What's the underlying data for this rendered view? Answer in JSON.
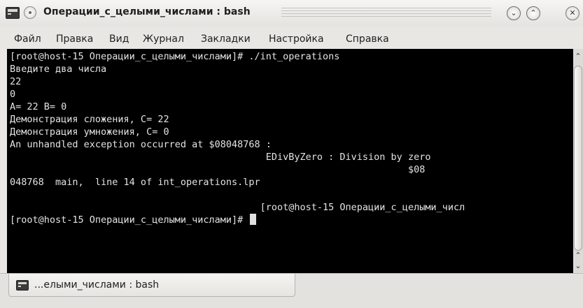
{
  "window": {
    "title": "Операции_с_целыми_числами : bash",
    "minimize_icon": "chevron-down",
    "maximize_icon": "chevron-up",
    "close_icon": "x"
  },
  "menu": [
    "Файл",
    "Правка",
    "Вид",
    "Журнал",
    "Закладки",
    "Настройка",
    "Справка"
  ],
  "terminal": {
    "lines": [
      "[root@host-15 Операции_с_целыми_числами]# ./int_operations",
      "Введите два числа",
      "22",
      "0",
      "A= 22 B= 0",
      "Демонстрация сложения, C= 22",
      "Демонстрация умножения, C= 0",
      "An unhandled exception occurred at $08048768 :",
      "                                             EDivByZero : Division by zero",
      "                                                                      $08",
      "048768  main,  line 14 of int_operations.lpr",
      "",
      "                                            [root@host-15 Операции_с_целыми_числ",
      "[root@host-15 Операции_с_целыми_числами]# "
    ]
  },
  "tabs": [
    {
      "label": "...елыми_числами : bash"
    }
  ]
}
